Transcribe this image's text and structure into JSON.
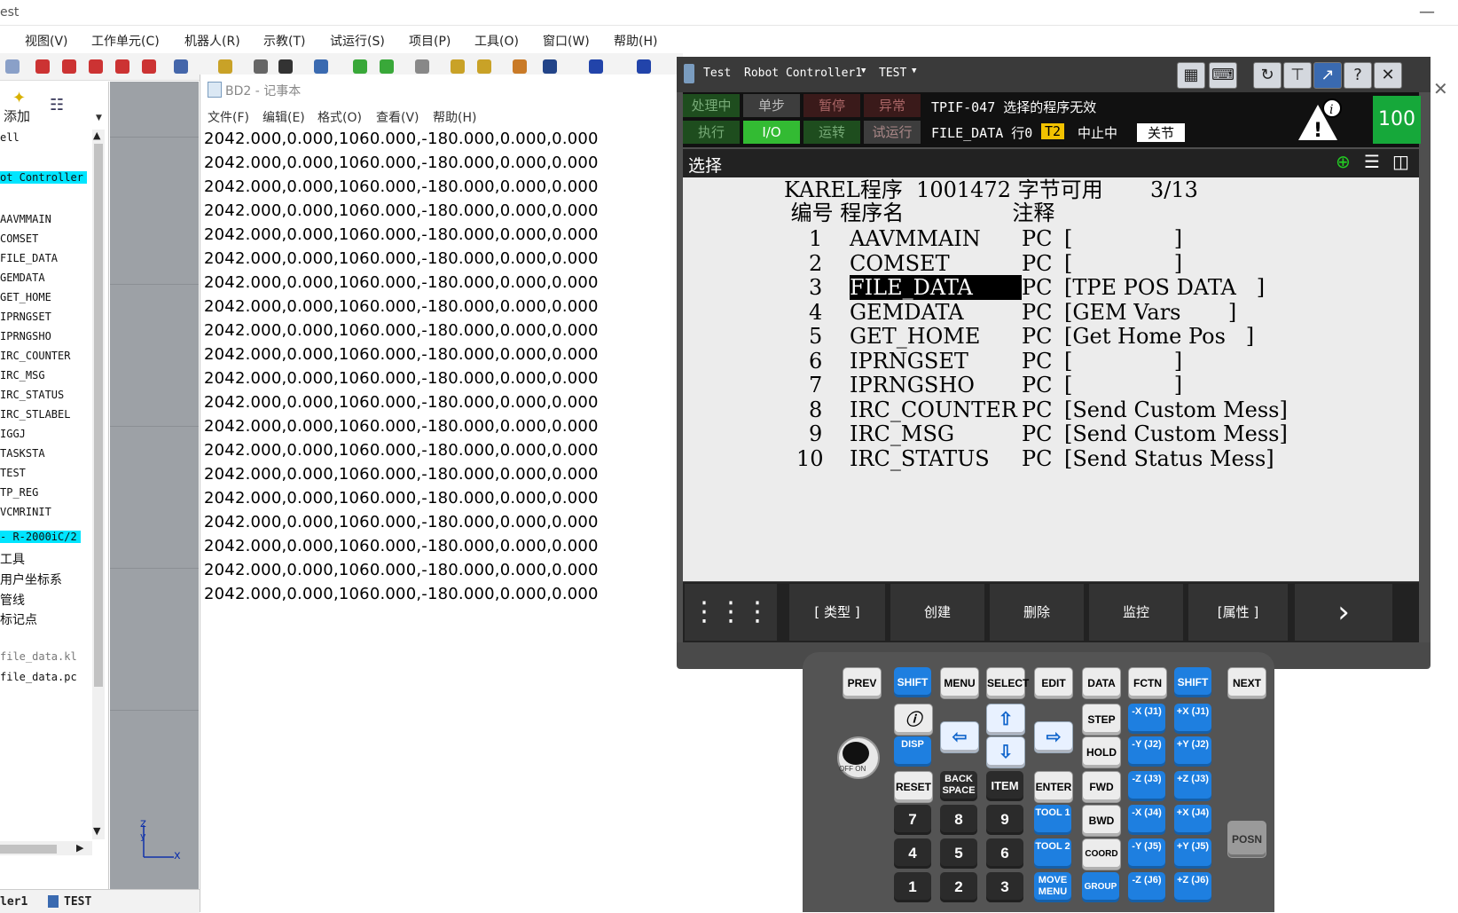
{
  "window": {
    "title": "est"
  },
  "menu": [
    "视图(V)",
    "工作单元(C)",
    "机器人(R)",
    "示教(T)",
    "试运行(S)",
    "项目(P)",
    "工具(O)",
    "窗口(W)",
    "帮助(H)"
  ],
  "left_panel": {
    "add_label": "添加",
    "items": [
      {
        "text": "ell",
        "hl": false
      },
      {
        "text": "ot Controller",
        "hl": true
      },
      {
        "text": "AAVMMAIN",
        "hl": false
      },
      {
        "text": "COMSET",
        "hl": false
      },
      {
        "text": "FILE_DATA",
        "hl": false
      },
      {
        "text": "GEMDATA",
        "hl": false
      },
      {
        "text": "GET_HOME",
        "hl": false
      },
      {
        "text": "IPRNGSET",
        "hl": false
      },
      {
        "text": "IPRNGSHO",
        "hl": false
      },
      {
        "text": "IRC_COUNTER",
        "hl": false
      },
      {
        "text": "IRC_MSG",
        "hl": false
      },
      {
        "text": "IRC_STATUS",
        "hl": false
      },
      {
        "text": "IRC_STLABEL",
        "hl": false
      },
      {
        "text": "IGGJ",
        "hl": false
      },
      {
        "text": "TASKSTA",
        "hl": false
      },
      {
        "text": "TEST",
        "hl": false
      },
      {
        "text": "TP_REG",
        "hl": false
      },
      {
        "text": "VCMRINIT",
        "hl": false
      },
      {
        "text": "- R-2000iC/2",
        "hl": true
      },
      {
        "text": "工具",
        "hl": false
      },
      {
        "text": "用户坐标系",
        "hl": false
      },
      {
        "text": "管线",
        "hl": false
      },
      {
        "text": "标记点",
        "hl": false
      },
      {
        "text": "file_data.kl",
        "hl": false
      },
      {
        "text": "file_data.pc",
        "hl": false
      }
    ],
    "bottom_tab1": "ler1",
    "bottom_tab2": "TEST"
  },
  "notepad": {
    "title": "BD2 - 记事本",
    "menu": [
      "文件(F)",
      "编辑(E)",
      "格式(O)",
      "查看(V)",
      "帮助(H)"
    ],
    "lines": [
      "2042.000,0.000,1060.000,-180.000,0.000,0.000",
      "2042.000,0.000,1060.000,-180.000,0.000,0.000",
      "2042.000,0.000,1060.000,-180.000,0.000,0.000",
      "2042.000,0.000,1060.000,-180.000,0.000,0.000",
      "2042.000,0.000,1060.000,-180.000,0.000,0.000",
      "2042.000,0.000,1060.000,-180.000,0.000,0.000",
      "2042.000,0.000,1060.000,-180.000,0.000,0.000",
      "2042.000,0.000,1060.000,-180.000,0.000,0.000",
      "2042.000,0.000,1060.000,-180.000,0.000,0.000",
      "2042.000,0.000,1060.000,-180.000,0.000,0.000",
      "2042.000,0.000,1060.000,-180.000,0.000,0.000",
      "2042.000,0.000,1060.000,-180.000,0.000,0.000",
      "2042.000,0.000,1060.000,-180.000,0.000,0.000",
      "2042.000,0.000,1060.000,-180.000,0.000,0.000",
      "2042.000,0.000,1060.000,-180.000,0.000,0.000",
      "2042.000,0.000,1060.000,-180.000,0.000,0.000",
      "2042.000,0.000,1060.000,-180.000,0.000,0.000",
      "2042.000,0.000,1060.000,-180.000,0.000,0.000",
      "2042.000,0.000,1060.000,-180.000,0.000,0.000",
      "2042.000,0.000,1060.000,-180.000,0.000,0.000"
    ]
  },
  "pendant": {
    "header": {
      "title": "Test",
      "controller": "Robot Controller1",
      "program": "TEST"
    },
    "status": {
      "busy": "处理中",
      "step": "单步",
      "hold": "暂停",
      "fault": "异常",
      "run": "执行",
      "io": "I/O",
      "prod": "运转",
      "tcyc": "试运行",
      "message": "TPIF-047 选择的程序无效",
      "line_info": "FILE_DATA 行0",
      "mode": "T2",
      "state": "中止中",
      "joint": "关节",
      "override": "100"
    },
    "screen_title": "选择",
    "list_header": "KAREL程序  1001472 字节可用       3/13",
    "col_header": " 编号 程序名                注释",
    "rows": [
      {
        "no": "1",
        "name": "AAVMMAIN",
        "type": "PC",
        "comment": "[               ]"
      },
      {
        "no": "2",
        "name": "COMSET",
        "type": "PC",
        "comment": "[               ]"
      },
      {
        "no": "3",
        "name": "FILE_DATA",
        "type": "PC",
        "comment": "[TPE POS DATA   ]"
      },
      {
        "no": "4",
        "name": "GEMDATA",
        "type": "PC",
        "comment": "[GEM Vars       ]"
      },
      {
        "no": "5",
        "name": "GET_HOME",
        "type": "PC",
        "comment": "[Get Home Pos   ]"
      },
      {
        "no": "6",
        "name": "IPRNGSET",
        "type": "PC",
        "comment": "[               ]"
      },
      {
        "no": "7",
        "name": "IPRNGSHO",
        "type": "PC",
        "comment": "[               ]"
      },
      {
        "no": "8",
        "name": "IRC_COUNTER",
        "type": "PC",
        "comment": "[Send Custom Mess]"
      },
      {
        "no": "9",
        "name": "IRC_MSG",
        "type": "PC",
        "comment": "[Send Custom Mess]"
      },
      {
        "no": "10",
        "name": "IRC_STATUS",
        "type": "PC",
        "comment": "[Send Status Mess]"
      }
    ],
    "fkeys": [
      "[ 类型 ]",
      "创建",
      "删除",
      "监控",
      "[属性 ]"
    ]
  },
  "keypad": {
    "row1": [
      "PREV",
      "SHIFT",
      "MENU",
      "SELECT",
      "EDIT",
      "DATA",
      "FCTN",
      "SHIFT",
      "NEXT"
    ],
    "disp": "DISP",
    "step": "STEP",
    "hold": "HOLD",
    "fwd": "FWD",
    "bwd": "BWD",
    "reset": "RESET",
    "backspace": "BACK SPACE",
    "item": "ITEM",
    "enter": "ENTER",
    "tool1": "TOOL 1",
    "tool2": "TOOL 2",
    "coord": "COORD",
    "group": "GROUP",
    "movemenu": "MOVE MENU",
    "posn": "POSN",
    "digits": [
      "7",
      "8",
      "9",
      "4",
      "5",
      "6",
      "1",
      "2",
      "3"
    ],
    "jog_neg": [
      "-X (J1)",
      "-Y (J2)",
      "-Z (J3)",
      "-X (J4)",
      "-Y (J5)",
      "-Z (J6)"
    ],
    "jog_pos": [
      "+X (J1)",
      "+Y (J2)",
      "+Z (J3)",
      "+X (J4)",
      "+Y (J5)",
      "+Z (J6)"
    ],
    "onoff": "OFF  ON"
  },
  "colors": {
    "highlight": "#00e5ff",
    "override_bg": "#16a83a",
    "io_green": "#33bb33",
    "mode_yellow": "#f2c200",
    "shift_blue": "#1e7fe0"
  }
}
